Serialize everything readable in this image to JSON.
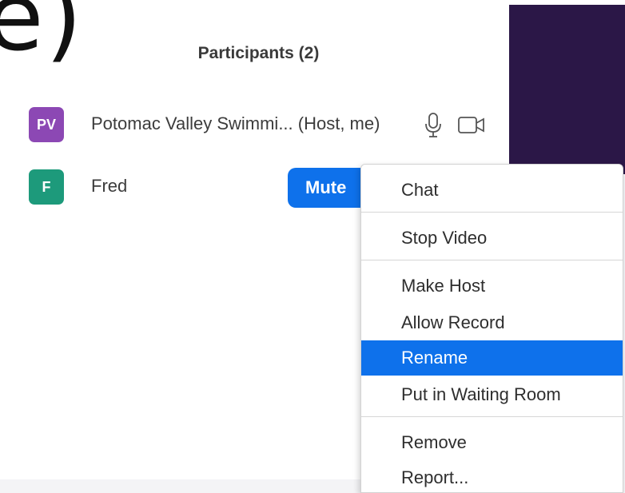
{
  "background_fragment": "e)",
  "header": {
    "title": "Participants (2)"
  },
  "participants": [
    {
      "initials": "PV",
      "name": "Potomac Valley Swimmi... (Host, me)",
      "avatar_color": "#8c48b4",
      "icons": [
        "microphone-icon",
        "video-camera-icon"
      ]
    },
    {
      "initials": "F",
      "name": "Fred",
      "avatar_color": "#1d9a7b",
      "action_label": "Mute"
    }
  ],
  "context_menu": {
    "items": [
      {
        "label": "Chat"
      },
      {
        "label": "Stop Video"
      },
      {
        "label": "Make Host"
      },
      {
        "label": "Allow Record"
      },
      {
        "label": "Rename",
        "selected": true
      },
      {
        "label": "Put in Waiting Room"
      },
      {
        "label": "Remove"
      },
      {
        "label": "Report..."
      }
    ]
  },
  "colors": {
    "accent": "#0e71eb",
    "panel_purple": "#2b1747"
  }
}
